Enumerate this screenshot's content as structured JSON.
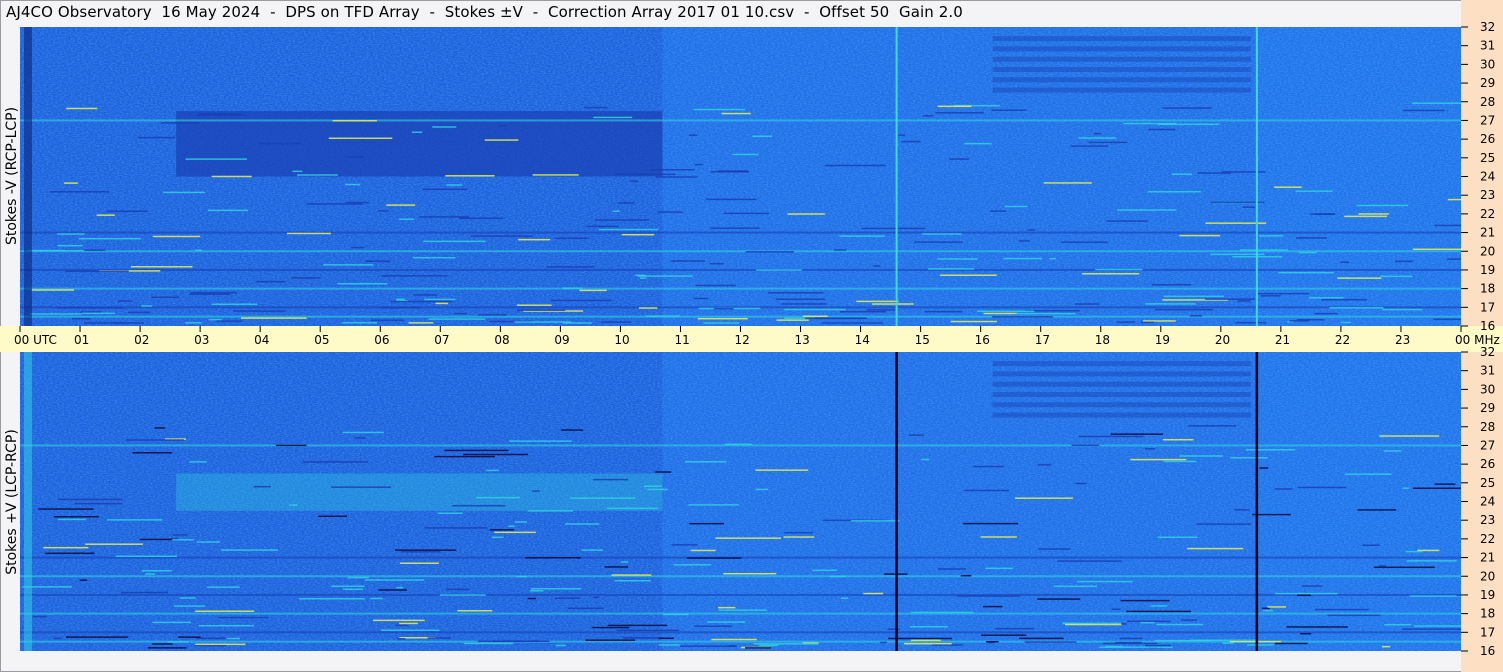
{
  "title": "AJ4CO Observatory  16 May 2024  -  DPS on TFD Array  -  Stokes ±V  -  Correction Array 2017 01 10.csv  -  Offset 50  Gain 2.0",
  "colors": {
    "background": "#f4f4f6",
    "time_axis_strip": "#fffbc8",
    "freq_axis_strip": "#fde0c4",
    "spectrogram_base": "#1f6fe8",
    "spectrogram_dark": "#1a40b4",
    "spectrogram_cyan": "#2fd0e0",
    "spectrogram_yellow": "#e8f050"
  },
  "chart_data": [
    {
      "type": "heatmap",
      "panel": "top",
      "ylabel": "Stokes -V (RCP-LCP)",
      "xlim_utc_hours": [
        0,
        24
      ],
      "ylim_mhz": [
        16,
        32
      ],
      "yticks": [
        "16",
        "17",
        "18",
        "19",
        "20",
        "21",
        "22",
        "23",
        "24",
        "25",
        "26",
        "27",
        "28",
        "29",
        "30",
        "31",
        "32"
      ],
      "features": {
        "vertical_lines_utc": [
          14.6,
          20.6
        ],
        "vertical_line_color": "cyan",
        "interference_bands_mhz": [
          27.0,
          21.0,
          20.0,
          19.0,
          18.0,
          17.0,
          16.5
        ],
        "dark_region_utc": [
          2.6,
          10.7
        ],
        "dark_region_mhz": [
          24.0,
          27.5
        ]
      }
    },
    {
      "type": "heatmap",
      "panel": "bottom",
      "ylabel": "Stokes +V (LCP-RCP)",
      "xlim_utc_hours": [
        0,
        24
      ],
      "ylim_mhz": [
        16,
        32
      ],
      "yticks": [
        "16",
        "17",
        "18",
        "19",
        "20",
        "21",
        "22",
        "23",
        "24",
        "25",
        "26",
        "27",
        "28",
        "29",
        "30",
        "31",
        "32"
      ],
      "features": {
        "vertical_lines_utc": [
          14.6,
          20.6
        ],
        "vertical_line_color": "black",
        "interference_bands_mhz": [
          27.0,
          21.0,
          20.0,
          19.0,
          18.0,
          17.0,
          16.5
        ],
        "bright_region_utc": [
          2.6,
          10.7
        ],
        "bright_region_mhz": [
          23.5,
          25.5
        ]
      }
    }
  ],
  "time_axis": {
    "labels": [
      "00 UTC",
      "01",
      "02",
      "03",
      "04",
      "05",
      "06",
      "07",
      "08",
      "09",
      "10",
      "11",
      "12",
      "13",
      "14",
      "15",
      "16",
      "17",
      "18",
      "19",
      "20",
      "21",
      "22",
      "23",
      "00 MHz"
    ]
  }
}
